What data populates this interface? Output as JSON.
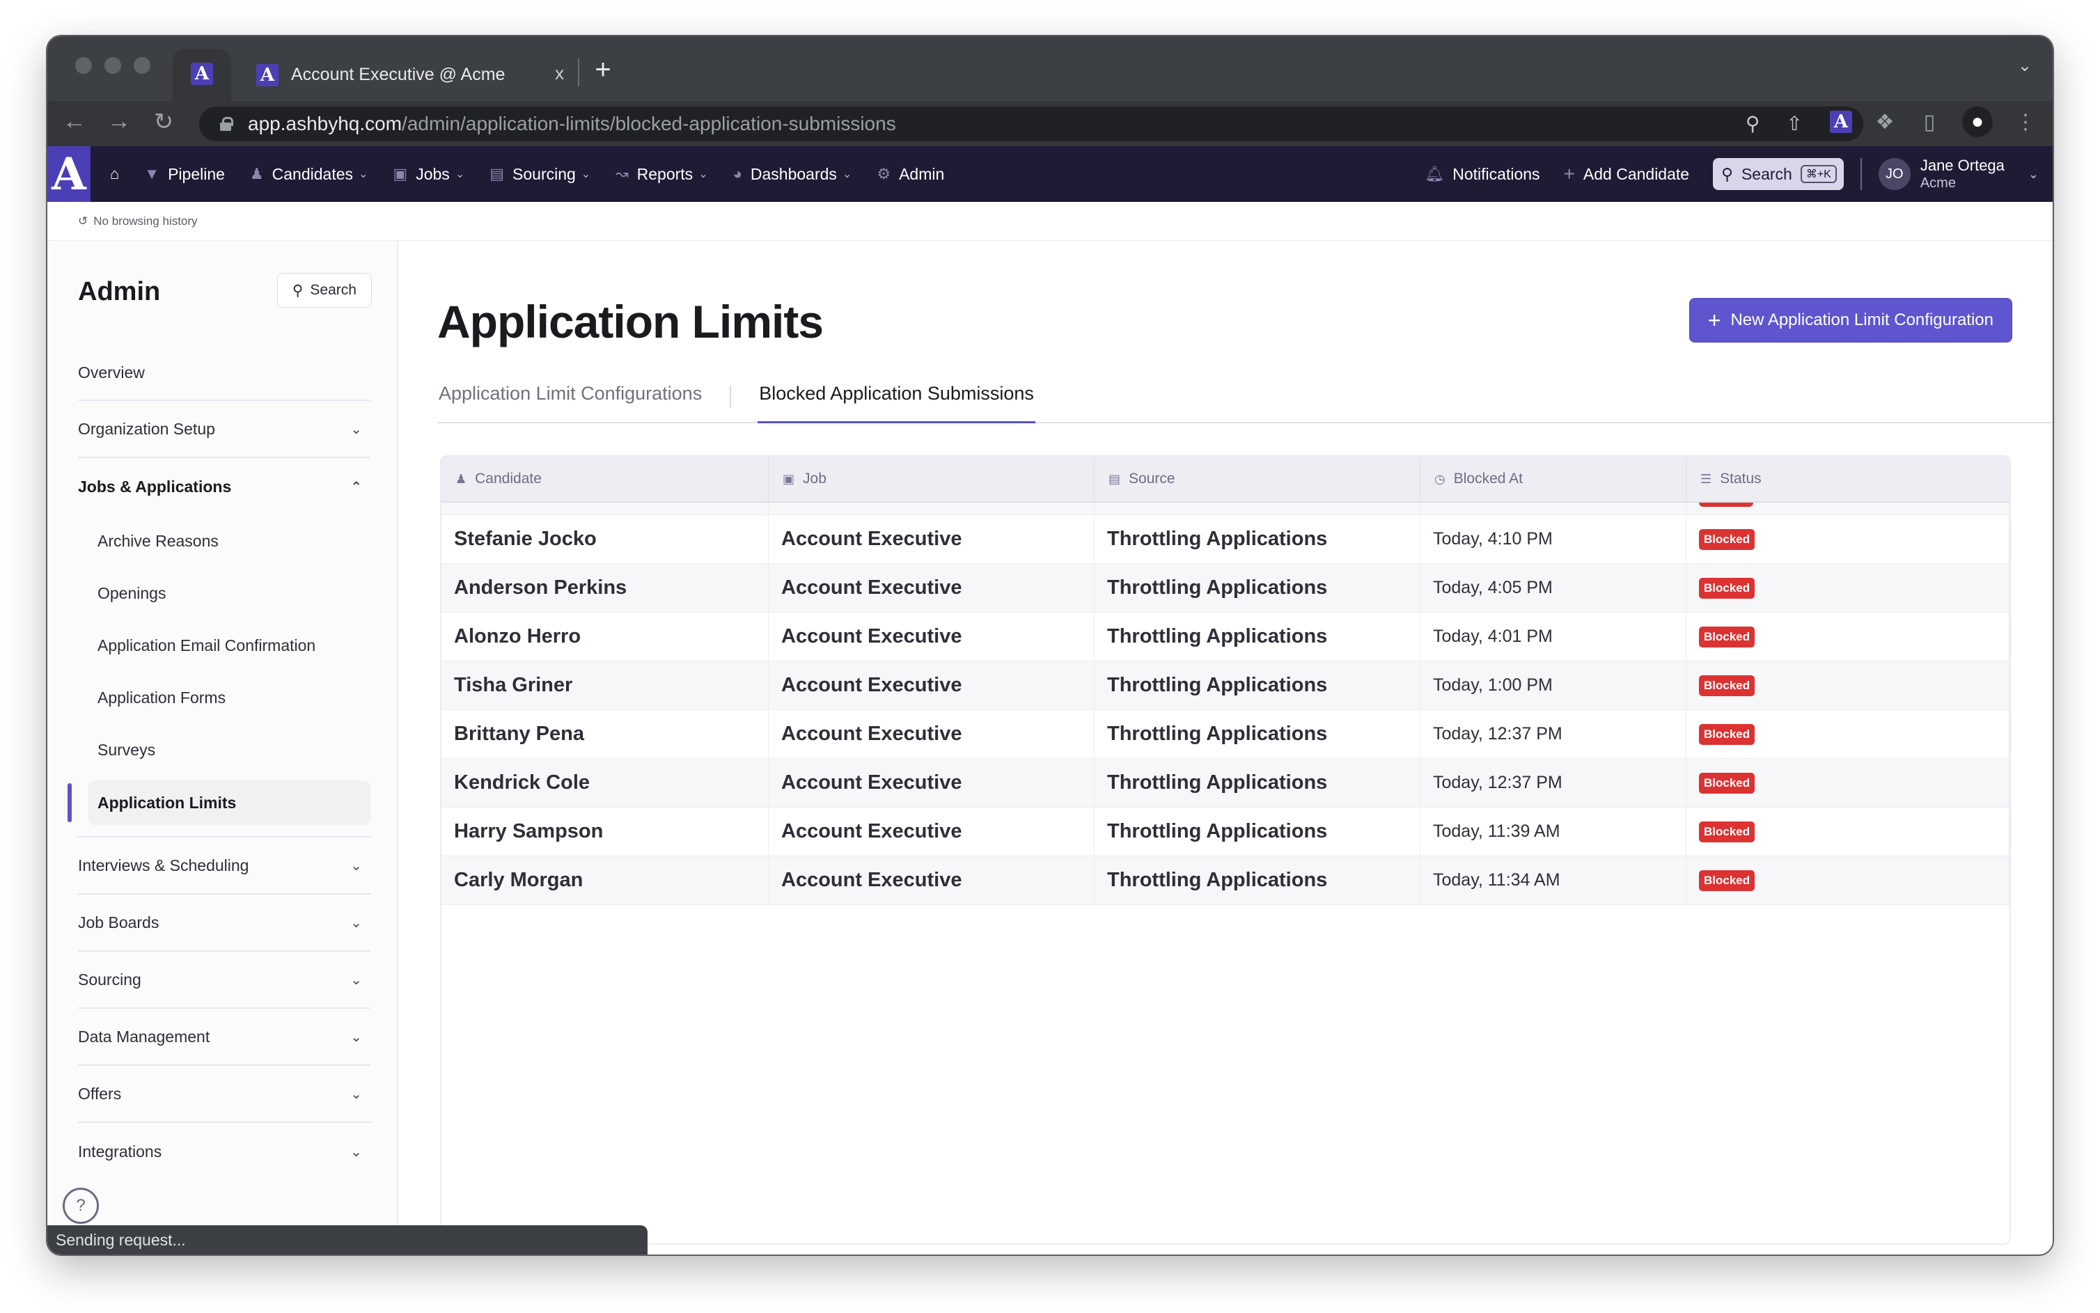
{
  "browser": {
    "tab_title": "Account Executive @ Acme",
    "tab_close": "x",
    "new_tab": "+",
    "url_host": "app.ashbyhq.com",
    "url_path": "/admin/application-limits/blocked-application-submissions",
    "favicon_letter": "A",
    "status_text": "Sending request..."
  },
  "appnav": {
    "brand_letter": "A",
    "items": [
      {
        "label": "Pipeline",
        "icon": "funnel-icon",
        "glyph": "▼",
        "dropdown": false
      },
      {
        "label": "Candidates",
        "icon": "candidates-icon",
        "glyph": "👥",
        "dropdown": true
      },
      {
        "label": "Jobs",
        "icon": "briefcase-icon",
        "glyph": "▣",
        "dropdown": true
      },
      {
        "label": "Sourcing",
        "icon": "sourcing-icon",
        "glyph": "▤",
        "dropdown": true
      },
      {
        "label": "Reports",
        "icon": "chart-icon",
        "glyph": "📈",
        "dropdown": true
      },
      {
        "label": "Dashboards",
        "icon": "gauge-icon",
        "glyph": "◕",
        "dropdown": true
      },
      {
        "label": "Admin",
        "icon": "gear-icon",
        "glyph": "⚙",
        "dropdown": false
      }
    ],
    "notifications_label": "Notifications",
    "add_candidate_label": "Add Candidate",
    "search_label": "Search",
    "search_shortcut": "⌘+K",
    "user": {
      "initials": "JO",
      "name": "Jane Ortega",
      "org": "Acme"
    }
  },
  "breadcrumb": {
    "text": "No browsing history"
  },
  "sidebar": {
    "title": "Admin",
    "search_label": "Search",
    "items": [
      {
        "label": "Overview",
        "expandable": false
      },
      {
        "label": "Organization Setup",
        "expandable": true
      },
      {
        "label": "Jobs & Applications",
        "expandable": true,
        "expanded": true,
        "children": [
          {
            "label": "Archive Reasons"
          },
          {
            "label": "Openings"
          },
          {
            "label": "Application Email Confirmation"
          },
          {
            "label": "Application Forms"
          },
          {
            "label": "Surveys"
          },
          {
            "label": "Application Limits",
            "active": true
          }
        ]
      },
      {
        "label": "Interviews & Scheduling",
        "expandable": true
      },
      {
        "label": "Job Boards",
        "expandable": true
      },
      {
        "label": "Sourcing",
        "expandable": true
      },
      {
        "label": "Data Management",
        "expandable": true
      },
      {
        "label": "Offers",
        "expandable": true
      },
      {
        "label": "Integrations",
        "expandable": true
      }
    ]
  },
  "main": {
    "title": "Application Limits",
    "new_button_label": "New Application Limit Configuration",
    "tabs": [
      {
        "label": "Application Limit Configurations",
        "active": false
      },
      {
        "label": "Blocked Application Submissions",
        "active": true
      }
    ],
    "table": {
      "columns": [
        {
          "label": "Candidate",
          "icon": "person-icon"
        },
        {
          "label": "Job",
          "icon": "briefcase-icon"
        },
        {
          "label": "Source",
          "icon": "source-icon"
        },
        {
          "label": "Blocked At",
          "icon": "clock-icon"
        },
        {
          "label": "Status",
          "icon": "checklist-icon"
        }
      ],
      "rows": [
        {
          "candidate": "Stefanie Jocko",
          "job": "Account Executive",
          "source": "Throttling Applications",
          "blocked_at": "Today, 4:10 PM",
          "status": "Blocked"
        },
        {
          "candidate": "Anderson Perkins",
          "job": "Account Executive",
          "source": "Throttling Applications",
          "blocked_at": "Today, 4:05 PM",
          "status": "Blocked"
        },
        {
          "candidate": "Alonzo Herro",
          "job": "Account Executive",
          "source": "Throttling Applications",
          "blocked_at": "Today, 4:01 PM",
          "status": "Blocked"
        },
        {
          "candidate": "Tisha Griner",
          "job": "Account Executive",
          "source": "Throttling Applications",
          "blocked_at": "Today, 1:00 PM",
          "status": "Blocked"
        },
        {
          "candidate": "Brittany Pena",
          "job": "Account Executive",
          "source": "Throttling Applications",
          "blocked_at": "Today, 12:37 PM",
          "status": "Blocked"
        },
        {
          "candidate": "Kendrick Cole",
          "job": "Account Executive",
          "source": "Throttling Applications",
          "blocked_at": "Today, 12:37 PM",
          "status": "Blocked"
        },
        {
          "candidate": "Harry Sampson",
          "job": "Account Executive",
          "source": "Throttling Applications",
          "blocked_at": "Today, 11:39 AM",
          "status": "Blocked"
        },
        {
          "candidate": "Carly Morgan",
          "job": "Account Executive",
          "source": "Throttling Applications",
          "blocked_at": "Today, 11:34 AM",
          "status": "Blocked"
        }
      ]
    }
  },
  "colors": {
    "brand": "#4b3fb5",
    "nav_bg": "#1e1c35",
    "accent": "#5f55cf",
    "blocked": "#dc3232"
  }
}
